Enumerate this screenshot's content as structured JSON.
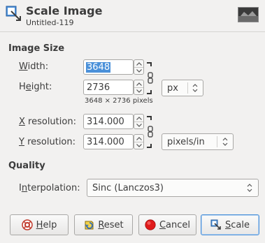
{
  "header": {
    "title": "Scale Image",
    "subtitle": "Untitled-119",
    "icon": "scale-image-icon",
    "thumbnail": "image-thumbnail"
  },
  "image_size": {
    "section_label": "Image Size",
    "width": {
      "label_pre": "",
      "label_u": "W",
      "label_post": "idth:",
      "value": "3648"
    },
    "height": {
      "label_pre": "H",
      "label_u": "e",
      "label_post": "ight:",
      "value": "2736"
    },
    "unit": "px",
    "pixel_info": "3648 × 2736 pixels",
    "x_res": {
      "label_u": "X",
      "label_post": " resolution:",
      "value": "314.000"
    },
    "y_res": {
      "label_u": "Y",
      "label_post": " resolution:",
      "value": "314.000"
    },
    "res_unit": "pixels/in",
    "chain_icon": "chain-link-icon"
  },
  "quality": {
    "section_label": "Quality",
    "interp": {
      "label_pre": "I",
      "label_u": "n",
      "label_post": "terpolation:",
      "value": "Sinc (Lanczos3)"
    }
  },
  "buttons": {
    "help": {
      "u": "H",
      "rest": "elp"
    },
    "reset": {
      "u": "R",
      "rest": "eset"
    },
    "cancel": {
      "u": "C",
      "rest": "ancel"
    },
    "scale": {
      "u": "S",
      "rest": "cale"
    }
  },
  "colors": {
    "accent": "#4a90d9",
    "background": "#f2f1f0",
    "cancel_red": "#e01b1b"
  }
}
